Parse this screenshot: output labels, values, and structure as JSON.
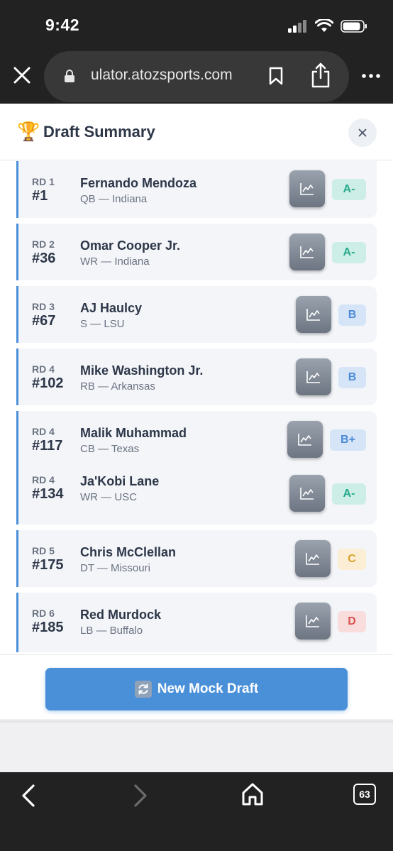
{
  "status_bar": {
    "time": "9:42"
  },
  "browser": {
    "url": "ulator.atozsports.com",
    "tab_count": "63"
  },
  "modal": {
    "title": "Draft Summary",
    "close_label": "×",
    "footer_button": "New Mock Draft"
  },
  "picks": [
    {
      "round": "RD 1",
      "number": "#1",
      "name": "Fernando Mendoza",
      "info": "QB — Indiana",
      "grade": "A-"
    },
    {
      "round": "RD 2",
      "number": "#36",
      "name": "Omar Cooper Jr.",
      "info": "WR — Indiana",
      "grade": "A-"
    },
    {
      "round": "RD 3",
      "number": "#67",
      "name": "AJ Haulcy",
      "info": "S — LSU",
      "grade": "B"
    },
    {
      "round": "RD 4",
      "number": "#102",
      "name": "Mike Washington Jr.",
      "info": "RB — Arkansas",
      "grade": "B"
    },
    {
      "round": "RD 4",
      "number": "#117",
      "name": "Malik Muhammad",
      "info": "CB — Texas",
      "grade": "B+"
    },
    {
      "round": "RD 4",
      "number": "#134",
      "name": "Ja'Kobi Lane",
      "info": "WR — USC",
      "grade": "A-"
    },
    {
      "round": "RD 5",
      "number": "#175",
      "name": "Chris McClellan",
      "info": "DT — Missouri",
      "grade": "C"
    },
    {
      "round": "RD 6",
      "number": "#185",
      "name": "Red Murdock",
      "info": "LB — Buffalo",
      "grade": "D"
    }
  ],
  "colors": {
    "accent": "#4a90d9",
    "grade_a_minus": "#27a98c",
    "grade_b": "#4a8ad6",
    "grade_c": "#d9a22a",
    "grade_d": "#d9534f"
  },
  "icons": [
    "wifi-icon",
    "signal-icon",
    "battery-icon",
    "close-icon",
    "lock-icon",
    "bookmark-icon",
    "share-icon",
    "more-icon",
    "trophy-icon",
    "chart-icon",
    "refresh-icon",
    "back-icon",
    "forward-icon",
    "home-icon",
    "tabs-icon"
  ]
}
